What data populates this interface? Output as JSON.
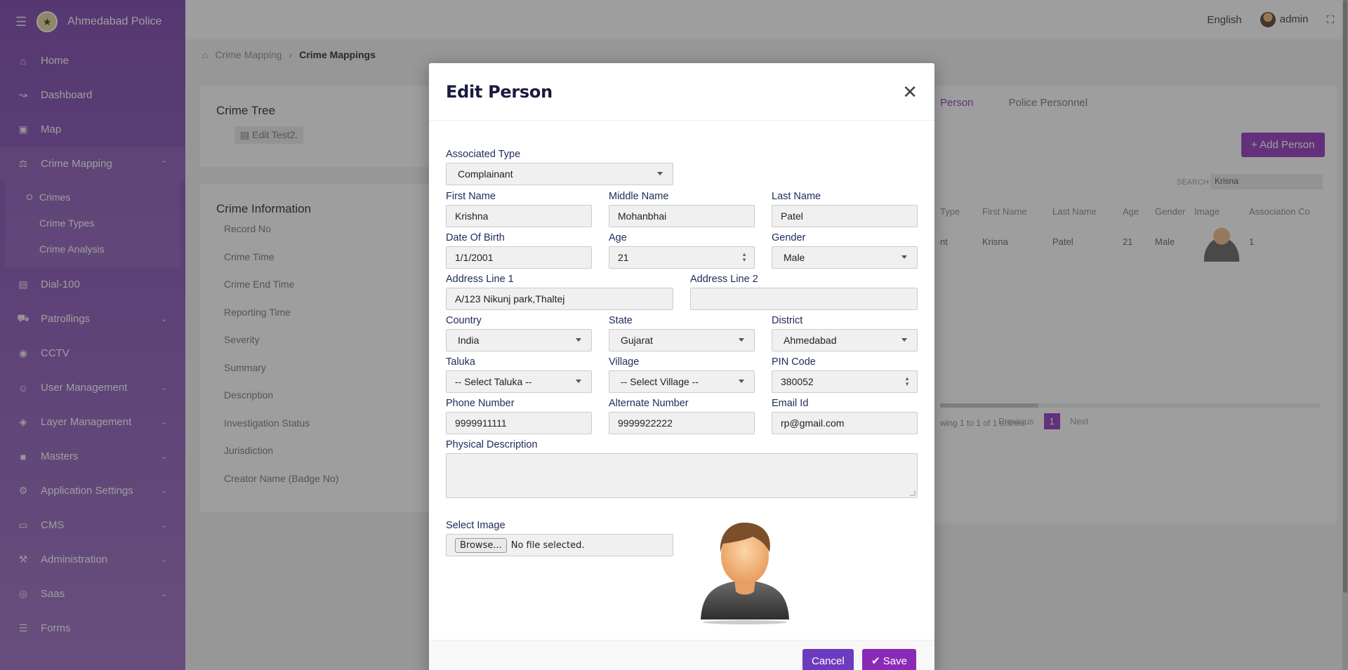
{
  "app": {
    "brand": "Ahmedabad Police",
    "language": "English",
    "user": "admin"
  },
  "sidebar": {
    "items": [
      {
        "label": "Home",
        "icon": "home-icon"
      },
      {
        "label": "Dashboard",
        "icon": "chart-line-icon"
      },
      {
        "label": "Map",
        "icon": "map-icon"
      },
      {
        "label": "Crime Mapping",
        "icon": "crime-icon"
      },
      {
        "label": "Dial-100",
        "icon": "file-icon"
      },
      {
        "label": "Patrollings",
        "icon": "car-icon"
      },
      {
        "label": "CCTV",
        "icon": "camera-icon"
      },
      {
        "label": "User Management",
        "icon": "users-icon"
      },
      {
        "label": "Layer Management",
        "icon": "layers-icon"
      },
      {
        "label": "Masters",
        "icon": "masters-icon"
      },
      {
        "label": "Application Settings",
        "icon": "settings-icon"
      },
      {
        "label": "CMS",
        "icon": "cms-icon"
      },
      {
        "label": "Administration",
        "icon": "wrench-icon"
      },
      {
        "label": "Saas",
        "icon": "globe-icon"
      },
      {
        "label": "Forms",
        "icon": "forms-icon"
      }
    ],
    "crime_sub": [
      "Crimes",
      "Crime Types",
      "Crime Analysis"
    ]
  },
  "breadcrumb": {
    "parent": "Crime Mapping",
    "current": "Crime Mappings"
  },
  "crime_tree": {
    "title": "Crime Tree",
    "node": "Edit Test2."
  },
  "crime_info": {
    "title": "Crime Information",
    "rows": [
      "Record No",
      "Crime Time",
      "Crime End Time",
      "Reporting Time",
      "Severity",
      "Summary",
      "Description",
      "Investigation Status",
      "Jurisdiction",
      "Creator Name (Badge No)"
    ]
  },
  "person_panel": {
    "tabs": [
      "Person",
      "Police Personnel"
    ],
    "add_label": "Add Person",
    "search_label": "SEARCH",
    "search_value": "Krisna",
    "columns": [
      "Type",
      "First Name",
      "Last Name",
      "Age",
      "Gender",
      "Image",
      "Association Co"
    ],
    "row": [
      "nt",
      "Krisna",
      "Patel",
      "21",
      "Male",
      "",
      "1"
    ],
    "info": "wing 1 to 1 of 1 entries",
    "prev": "Previous",
    "page": "1",
    "next": "Next"
  },
  "modal": {
    "title": "Edit Person",
    "associated_type": {
      "label": "Associated Type",
      "value": "Complainant"
    },
    "first_name": {
      "label": "First Name",
      "value": "Krishna"
    },
    "middle_name": {
      "label": "Middle Name",
      "value": "Mohanbhai"
    },
    "last_name": {
      "label": "Last Name",
      "value": "Patel"
    },
    "dob": {
      "label": "Date Of Birth",
      "value": "1/1/2001"
    },
    "age": {
      "label": "Age",
      "value": "21"
    },
    "gender": {
      "label": "Gender",
      "value": "Male"
    },
    "address1": {
      "label": "Address Line 1",
      "value": "A/123 Nikunj park,Thaltej"
    },
    "address2": {
      "label": "Address Line 2",
      "value": ""
    },
    "country": {
      "label": "Country",
      "value": "India"
    },
    "state": {
      "label": "State",
      "value": "Gujarat"
    },
    "district": {
      "label": "District",
      "value": "Ahmedabad"
    },
    "taluka": {
      "label": "Taluka",
      "value": "-- Select Taluka --"
    },
    "village": {
      "label": "Village",
      "value": "-- Select Village --"
    },
    "pin": {
      "label": "PIN Code",
      "value": "380052"
    },
    "phone": {
      "label": "Phone Number",
      "value": "9999911111"
    },
    "alt_phone": {
      "label": "Alternate Number",
      "value": "9999922222"
    },
    "email": {
      "label": "Email Id",
      "value": "rp@gmail.com"
    },
    "physical": {
      "label": "Physical Description",
      "value": ""
    },
    "image": {
      "label": "Select Image",
      "browse": "Browse...",
      "status": "No file selected."
    },
    "cancel_label": "Cancel",
    "save_label": "Save"
  }
}
